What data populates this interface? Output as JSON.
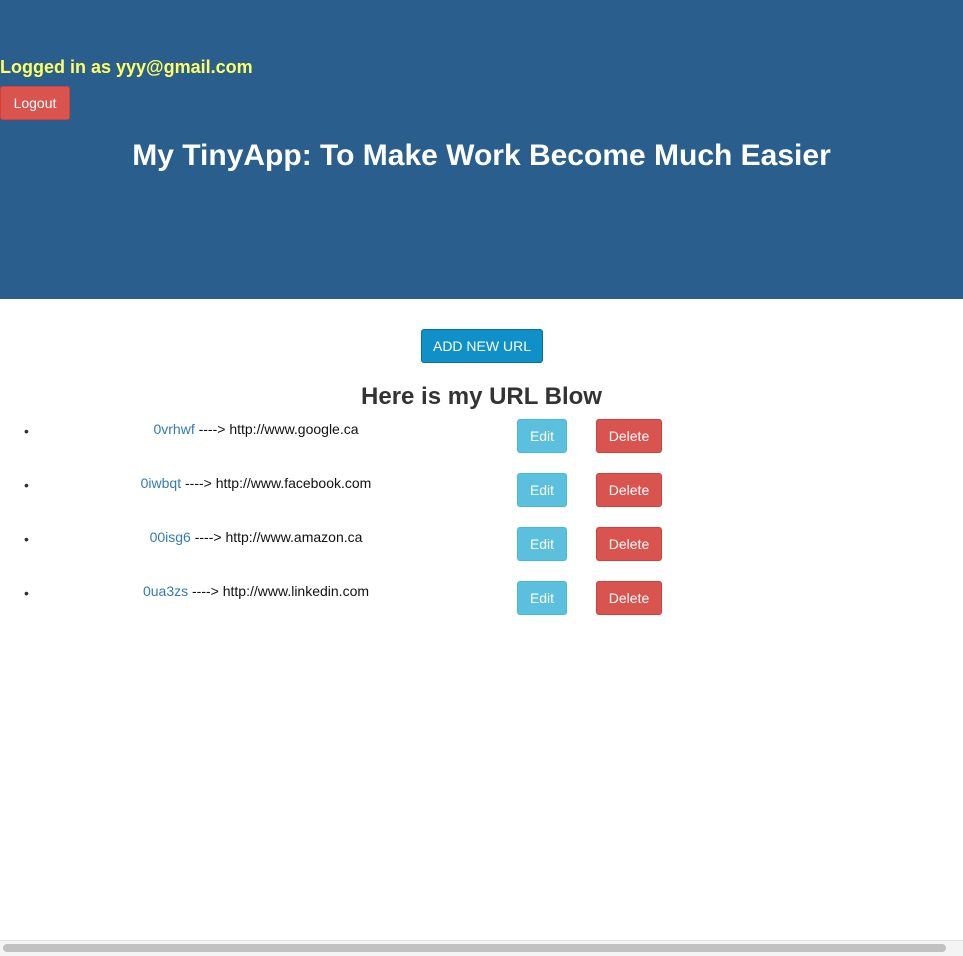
{
  "header": {
    "logged_in_text": "Logged in as yyy@gmail.com",
    "logout_label": "Logout",
    "title": "My TinyApp: To Make Work Become Much Easier"
  },
  "main": {
    "add_url_label": "ADD NEW URL",
    "list_heading": "Here is my URL Blow",
    "urls": [
      {
        "short": "0vrhwf",
        "arrow": " ----> ",
        "long": "http://www.google.ca",
        "edit": "Edit",
        "delete": "Delete"
      },
      {
        "short": "0iwbqt",
        "arrow": " ----> ",
        "long": "http://www.facebook.com",
        "edit": "Edit",
        "delete": "Delete"
      },
      {
        "short": "00isg6",
        "arrow": " ----> ",
        "long": "http://www.amazon.ca",
        "edit": "Edit",
        "delete": "Delete"
      },
      {
        "short": "0ua3zs",
        "arrow": " ----> ",
        "long": "http://www.linkedin.com",
        "edit": "Edit",
        "delete": "Delete"
      }
    ]
  },
  "colors": {
    "header_bg": "#2a5e8c",
    "logged_in_text": "#ffff66",
    "danger": "#d9534f",
    "info": "#5bc0de",
    "primary": "#0f90c8",
    "link": "#337ab7"
  }
}
